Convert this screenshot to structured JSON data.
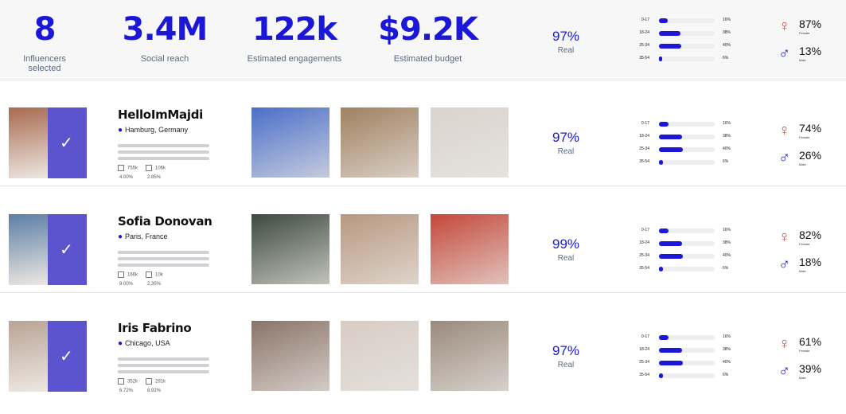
{
  "summary": {
    "influencers": {
      "value": "8",
      "label": "Influencers selected"
    },
    "reach": {
      "value": "3.4M",
      "label": "Social reach"
    },
    "engagements": {
      "value": "122k",
      "label": "Estimated engagements"
    },
    "budget": {
      "value": "$9.2K",
      "label": "Estimated budget"
    },
    "real": {
      "pct": "97%",
      "label": "Real"
    },
    "ages": [
      {
        "range": "0-17",
        "pct": "16%",
        "fill": 0.16
      },
      {
        "range": "18-24",
        "pct": "38%",
        "fill": 0.38
      },
      {
        "range": "25-34",
        "pct": "40%",
        "fill": 0.4
      },
      {
        "range": "35-54",
        "pct": "6%",
        "fill": 0.06
      }
    ],
    "female": {
      "pct": "87%",
      "label": "Female"
    },
    "male": {
      "pct": "13%",
      "label": "Male"
    }
  },
  "influencers": [
    {
      "name": "HelloImMajdi",
      "location": "Hamburg, Germany",
      "stat1": "755k",
      "stat1b": "4.00%",
      "stat2": "106k",
      "stat2b": "2.85%",
      "real": "97%",
      "real_label": "Real",
      "ages": [
        {
          "range": "0-17",
          "pct": "16%",
          "fill": 0.16
        },
        {
          "range": "18-24",
          "pct": "38%",
          "fill": 0.38
        },
        {
          "range": "25-34",
          "pct": "40%",
          "fill": 0.4
        },
        {
          "range": "35-54",
          "pct": "6%",
          "fill": 0.06
        }
      ],
      "female": "74%",
      "female_label": "Female",
      "male": "26%",
      "male_label": "Male",
      "colors": {
        "avatar": "#a86a50",
        "p1": "#4a6fc9",
        "p2": "#a08060",
        "p3": "#d9d4cc"
      }
    },
    {
      "name": "Sofia Donovan",
      "location": "Paris, France",
      "stat1": "166k",
      "stat1b": "9.00%",
      "stat2": "10k",
      "stat2b": "2.35%",
      "real": "99%",
      "real_label": "Real",
      "ages": [
        {
          "range": "0-17",
          "pct": "16%",
          "fill": 0.16
        },
        {
          "range": "18-24",
          "pct": "38%",
          "fill": 0.38
        },
        {
          "range": "25-34",
          "pct": "40%",
          "fill": 0.4
        },
        {
          "range": "35-54",
          "pct": "6%",
          "fill": 0.06
        }
      ],
      "female": "82%",
      "female_label": "Female",
      "male": "18%",
      "male_label": "Male",
      "colors": {
        "avatar": "#5c7fa6",
        "p1": "#3d4a3f",
        "p2": "#b89880",
        "p3": "#c4483a"
      }
    },
    {
      "name": "Iris Fabrino",
      "location": "Chicago, USA",
      "stat1": "352k",
      "stat1b": "6.72%",
      "stat2": "291k",
      "stat2b": "8.92%",
      "real": "97%",
      "real_label": "Real",
      "ages": [
        {
          "range": "0-17",
          "pct": "16%",
          "fill": 0.16
        },
        {
          "range": "18-24",
          "pct": "38%",
          "fill": 0.38
        },
        {
          "range": "25-34",
          "pct": "40%",
          "fill": 0.4
        },
        {
          "range": "35-54",
          "pct": "6%",
          "fill": 0.06
        }
      ],
      "female": "61%",
      "female_label": "Female",
      "male": "39%",
      "male_label": "Male",
      "colors": {
        "avatar": "#b9a496",
        "p1": "#8a7468",
        "p2": "#d7ccc4",
        "p3": "#9a8a7c"
      }
    }
  ]
}
